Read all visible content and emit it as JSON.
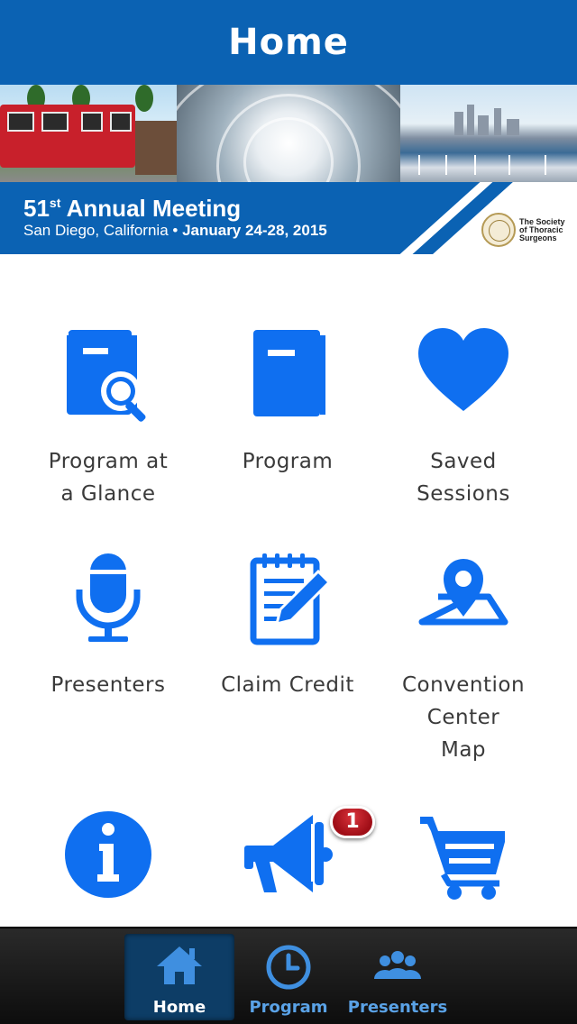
{
  "header": {
    "title": "Home"
  },
  "banner": {
    "meeting_num": "51",
    "meeting_suffix": "st",
    "meeting_title": "Annual Meeting",
    "location": "San Diego, California •",
    "dates": "January 24-28, 2015",
    "org_line1": "The Society",
    "org_line2": "of Thoracic",
    "org_line3": "Surgeons"
  },
  "tiles": [
    {
      "label_line1": "Program at",
      "label_line2": "a Glance",
      "icon": "book-search-icon"
    },
    {
      "label_line1": "Program",
      "icon": "book-icon"
    },
    {
      "label_line1": "Saved",
      "label_line2": "Sessions",
      "icon": "heart-icon"
    },
    {
      "label_line1": "Presenters",
      "icon": "microphone-icon"
    },
    {
      "label_line1": "Claim Credit",
      "icon": "notepad-pencil-icon"
    },
    {
      "label_line1": "Convention",
      "label_line2": "Center",
      "label_line3": "Map",
      "icon": "map-pin-icon"
    },
    {
      "icon": "info-icon"
    },
    {
      "icon": "megaphone-icon",
      "badge": "1"
    },
    {
      "icon": "cart-icon"
    }
  ],
  "tabbar": {
    "items": [
      {
        "label": "Home",
        "icon": "home-icon",
        "active": true
      },
      {
        "label": "Program",
        "icon": "clock-icon",
        "active": false
      },
      {
        "label": "Presenters",
        "icon": "people-icon",
        "active": false
      }
    ]
  },
  "colors": {
    "accent": "#0b62b3",
    "icon_blue": "#0f6ff0",
    "badge_red": "#b5121b",
    "tabbar_bg": "#111111"
  }
}
